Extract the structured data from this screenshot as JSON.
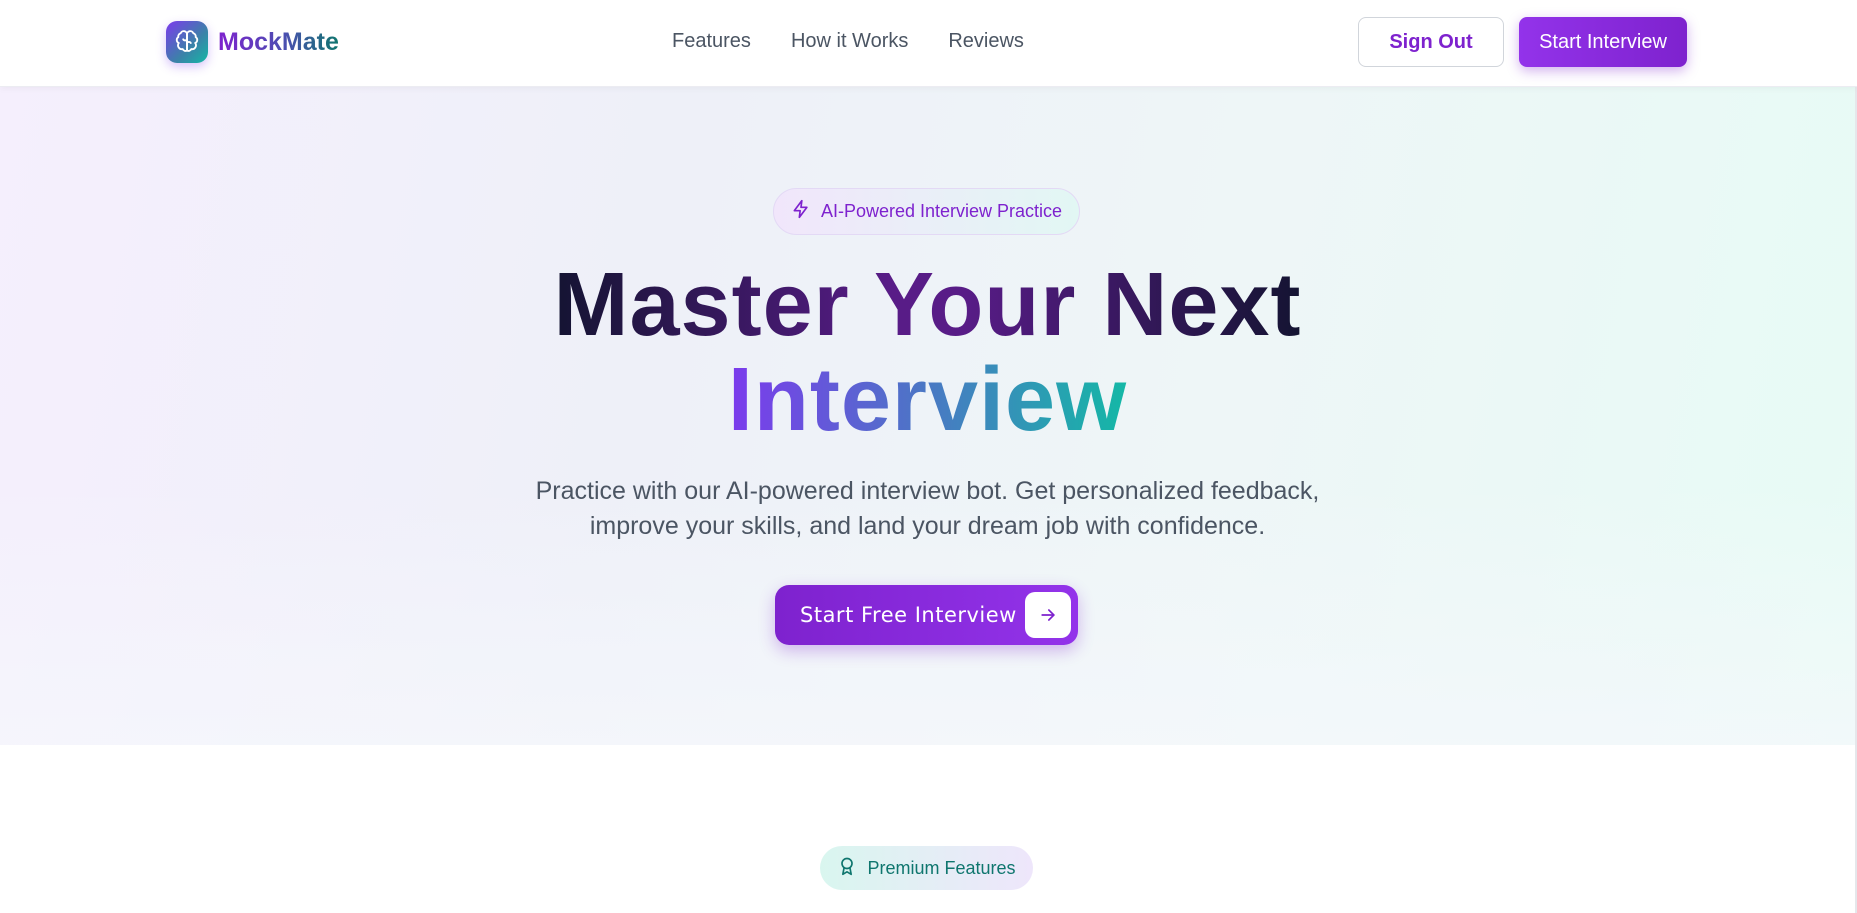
{
  "header": {
    "brand": "MockMate",
    "nav": [
      "Features",
      "How it Works",
      "Reviews"
    ],
    "sign_out": "Sign Out",
    "start_interview": "Start Interview"
  },
  "hero": {
    "badge": "AI-Powered Interview Practice",
    "title_line1": "Master Your Next",
    "title_line2": "Interview",
    "subtitle_line1": "Practice with our AI-powered interview bot. Get personalized feedback,",
    "subtitle_line2": "improve your skills, and land your dream job with confidence.",
    "cta": "Start Free Interview"
  },
  "features": {
    "badge": "Premium Features"
  },
  "icons": {
    "logo": "brain-icon",
    "badge": "lightning-icon",
    "cta": "arrow-right-icon",
    "premium": "award-icon"
  },
  "colors": {
    "primary": "#7e22ce",
    "accent": "#14b8a6"
  }
}
